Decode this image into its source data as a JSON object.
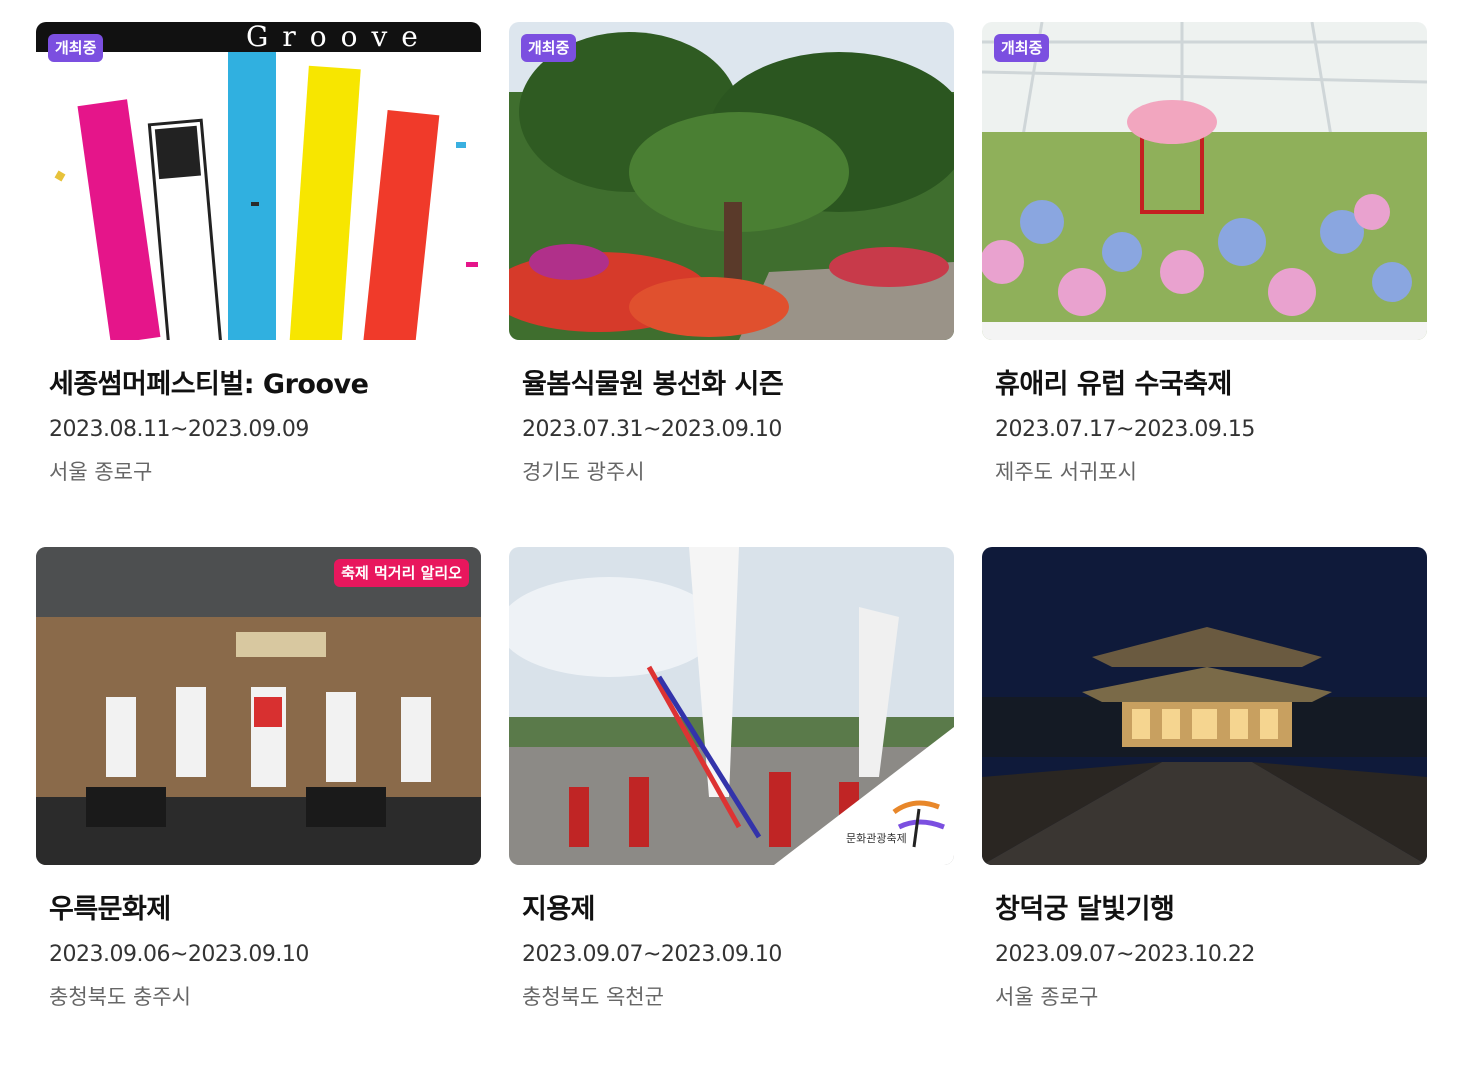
{
  "cards": [
    {
      "title": "세종썸머페스티벌: Groove",
      "date": "2023.08.11~2023.09.09",
      "location": "서울 종로구",
      "badge": "개최중",
      "poster_text": "Groove"
    },
    {
      "title": "율봄식물원 봉선화 시즌",
      "date": "2023.07.31~2023.09.10",
      "location": "경기도 광주시",
      "badge": "개최중"
    },
    {
      "title": "휴애리 유럽 수국축제",
      "date": "2023.07.17~2023.09.15",
      "location": "제주도 서귀포시",
      "badge": "개최중"
    },
    {
      "title": "우륵문화제",
      "date": "2023.09.06~2023.09.10",
      "location": "충청북도 충주시",
      "badge": "축제 먹거리 알리오"
    },
    {
      "title": "지용제",
      "date": "2023.09.07~2023.09.10",
      "location": "충청북도 옥천군",
      "corner_label": "문화관광축제"
    },
    {
      "title": "창덕궁 달빛기행",
      "date": "2023.09.07~2023.10.22",
      "location": "서울 종로구"
    }
  ],
  "colors": {
    "badge_live": "#7b4fe0",
    "badge_food": "#e8175d"
  }
}
